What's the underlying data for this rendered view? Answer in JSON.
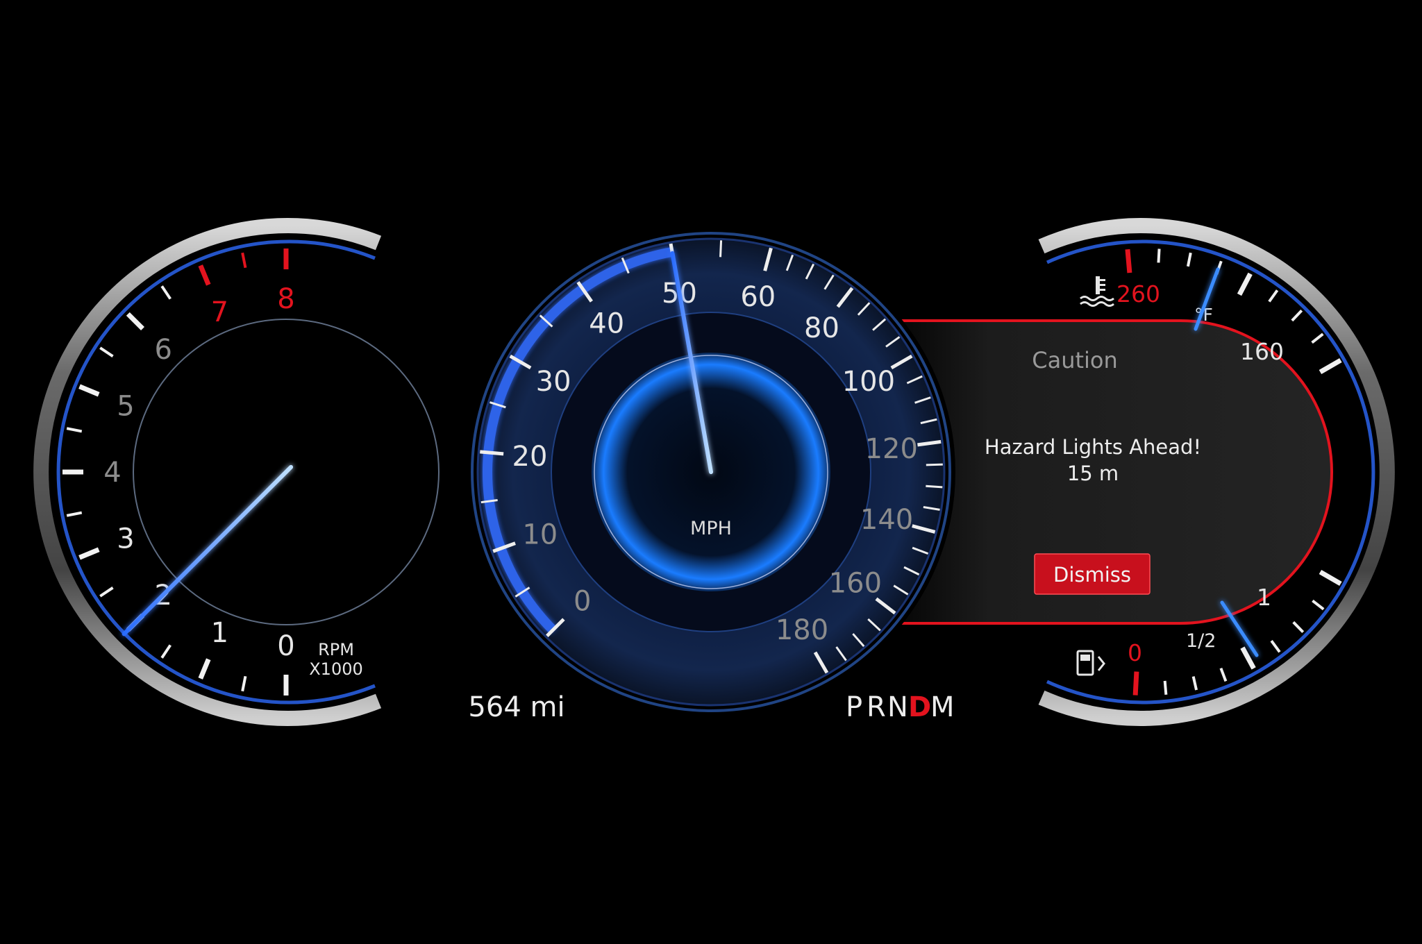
{
  "tachometer": {
    "numerals": [
      "0",
      "1",
      "2",
      "3",
      "4",
      "5",
      "6",
      "7",
      "8"
    ],
    "redline_from": 7,
    "needle_value": 2,
    "unit_line1": "RPM",
    "unit_line2": "X1000"
  },
  "speedometer": {
    "numerals": [
      "0",
      "10",
      "20",
      "30",
      "40",
      "50",
      "60",
      "80",
      "100",
      "120",
      "140",
      "160",
      "180"
    ],
    "needle_value": 50,
    "unit": "MPH"
  },
  "odometer": {
    "range": "564 mi"
  },
  "gear_selector": {
    "letters": [
      "P",
      "R",
      "N",
      "D",
      "M"
    ],
    "selected": "D"
  },
  "alert": {
    "title": "Caution",
    "message_line1": "Hazard Lights Ahead!",
    "message_line2": "15 m",
    "button": "Dismiss"
  },
  "temperature_gauge": {
    "icon": "coolant-temperature-icon",
    "max_label": "260",
    "mid_label": "160",
    "unit": "°F"
  },
  "fuel_gauge": {
    "icon": "fuel-pump-icon",
    "empty_label": "0",
    "half_label": "1/2",
    "full_label": "1"
  },
  "colors": {
    "accent_blue": "#3a8cff",
    "alert_red": "#e3131e",
    "button_red": "#c8101d",
    "numeral_gray": "#8c8c8c",
    "numeral_white": "#e6e6e6"
  }
}
